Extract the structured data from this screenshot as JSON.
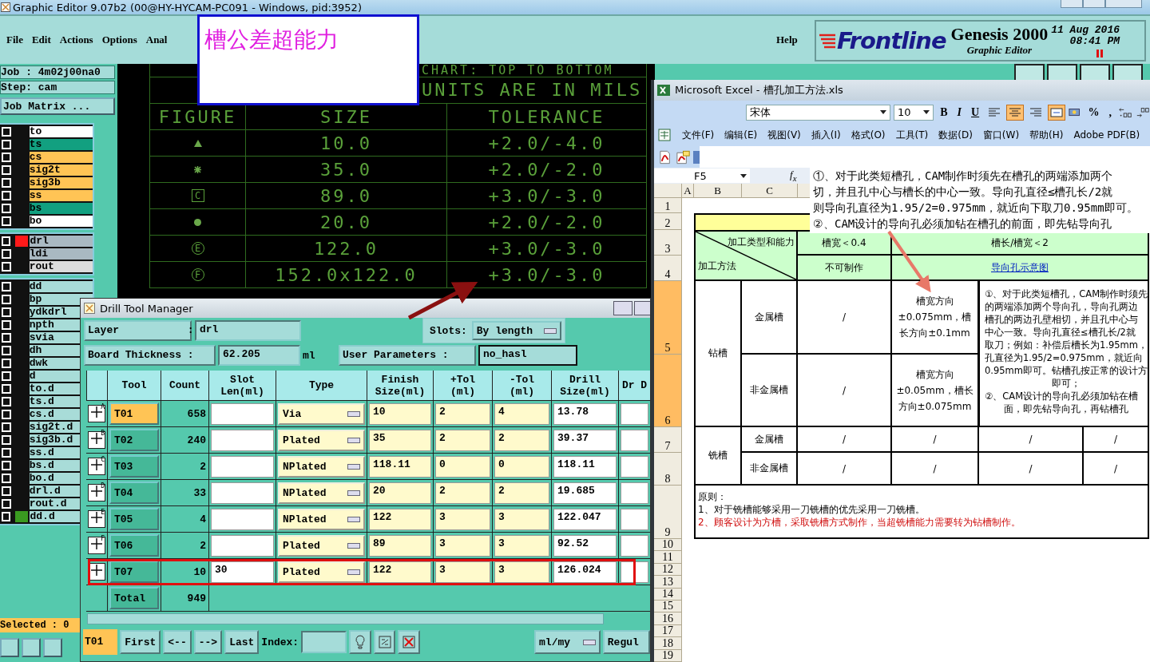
{
  "main_window": {
    "title": "Graphic Editor 9.07b2 (00@HY-HYCAM-PC091 - Windows, pid:3952)"
  },
  "menu": [
    "File",
    "Edit",
    "Actions",
    "Options",
    "Anal"
  ],
  "help_menu": "Help",
  "brand": {
    "logo": "Frontline",
    "product": "Genesis 2000",
    "subtitle": "Graphic Editor",
    "date": "11 Aug  2016",
    "time": "08:41  PM"
  },
  "overlay_note": "槽公差超能力",
  "job": {
    "job": "Job : 4m02j00na0",
    "step": "Step: cam",
    "matrix_button": "Job Matrix ..."
  },
  "layer_groups": [
    [
      {
        "name": "to",
        "color": "#ffffff",
        "checked": false
      },
      {
        "name": "ts",
        "color": "#12a080",
        "checked": false
      },
      {
        "name": "cs",
        "color": "#ffc455",
        "checked": false
      },
      {
        "name": "sig2t",
        "color": "#ffc455",
        "checked": false
      },
      {
        "name": "sig3b",
        "color": "#ffc455",
        "checked": false
      },
      {
        "name": "ss",
        "color": "#ffc455",
        "checked": false
      },
      {
        "name": "bs",
        "color": "#12a080",
        "checked": false
      },
      {
        "name": "bo",
        "color": "#ffffff",
        "checked": false
      }
    ],
    [
      {
        "name": "drl",
        "color": "#a9b9c2",
        "checked": false,
        "swatch": {
          "color": "#ff1a1a"
        }
      },
      {
        "name": "ldi",
        "color": "#a9b9c2",
        "checked": false
      },
      {
        "name": "rout",
        "color": "#dcdcdc",
        "checked": false
      }
    ],
    [
      {
        "name": "dd",
        "color": "#a8dcd8",
        "checked": false
      },
      {
        "name": "bp",
        "color": "#a8dcd8",
        "checked": false
      },
      {
        "name": "ydkdrl",
        "color": "#a8dcd8",
        "checked": false
      },
      {
        "name": "npth",
        "color": "#a8dcd8",
        "checked": false
      },
      {
        "name": "svia",
        "color": "#a8dcd8",
        "checked": false
      },
      {
        "name": "dh",
        "color": "#a8dcd8",
        "checked": false
      },
      {
        "name": "dwk",
        "color": "#a8dcd8",
        "checked": false
      },
      {
        "name": "d",
        "color": "#a8dcd8",
        "checked": false
      },
      {
        "name": "to.d",
        "color": "#a8dcd8",
        "checked": false
      },
      {
        "name": "ts.d",
        "color": "#a8dcd8",
        "checked": false
      },
      {
        "name": "cs.d",
        "color": "#a8dcd8",
        "checked": false
      },
      {
        "name": "sig2t.d",
        "color": "#a8dcd8",
        "checked": false
      },
      {
        "name": "sig3b.d",
        "color": "#a8dcd8",
        "checked": false
      },
      {
        "name": "ss.d",
        "color": "#a8dcd8",
        "checked": false
      },
      {
        "name": "bs.d",
        "color": "#a8dcd8",
        "checked": false
      },
      {
        "name": "bo.d",
        "color": "#a8dcd8",
        "checked": false
      },
      {
        "name": "drl.d",
        "color": "#a8dcd8",
        "checked": false
      },
      {
        "name": "rout.d",
        "color": "#a8dcd8",
        "checked": false
      },
      {
        "name": "dd.d",
        "color": "#a8dcd8",
        "checked": false,
        "swatch": {
          "color": "#3a9a20"
        }
      }
    ]
  ],
  "selected_count": "Selected : 0",
  "chart": {
    "title": "CHART: TOP TO BOTTOM",
    "units": "UNITS ARE IN MILS",
    "columns": [
      "FIGURE",
      "SIZE",
      "TOLERANCE"
    ],
    "rows": [
      {
        "kind": "triangle",
        "size": "10.0",
        "tolerance": "+2.0/-4.0"
      },
      {
        "kind": "star",
        "size": "35.0",
        "tolerance": "+2.0/-2.0"
      },
      {
        "kind": "boxed",
        "symbol": "C",
        "size": "89.0",
        "tolerance": "+3.0/-3.0"
      },
      {
        "kind": "dot",
        "size": "20.0",
        "tolerance": "+2.0/-2.0"
      },
      {
        "kind": "circled",
        "symbol": "E",
        "size": "122.0",
        "tolerance": "+3.0/-3.0"
      },
      {
        "kind": "circled",
        "symbol": "F",
        "size": "152.0x122.0",
        "tolerance": "+3.0/-3.0"
      }
    ]
  },
  "drill_tool_manager": {
    "title": "Drill Tool Manager",
    "layer_label": "Layer           :",
    "layer": "drl",
    "slots_label": "Slots:",
    "slots": "By length",
    "thickness_label": "Board Thickness :",
    "thickness": "62.205",
    "thickness_unit": "ml",
    "params_label": "User Parameters :",
    "params": "no_hasl",
    "columns": [
      "Tool",
      "Count",
      "Slot Len(ml)",
      "Type",
      "Finish Size(ml)",
      "+Tol (ml)",
      "-Tol (ml)",
      "Drill Size(ml)",
      "Dr D"
    ],
    "rows": [
      {
        "letter": "A",
        "tool": "T01",
        "selected": true,
        "count": "658",
        "type": "Via",
        "finish": "10",
        "plus_tol": "2",
        "minus_tol": "4",
        "drill": "13.78"
      },
      {
        "letter": "B",
        "tool": "T02",
        "selected": false,
        "count": "240",
        "type": "Plated",
        "finish": "35",
        "plus_tol": "2",
        "minus_tol": "2",
        "drill": "39.37"
      },
      {
        "letter": "C",
        "tool": "T03",
        "selected": false,
        "count": "2",
        "type": "NPlated",
        "finish": "118.11",
        "plus_tol": "0",
        "minus_tol": "0",
        "drill": "118.11"
      },
      {
        "letter": "D",
        "tool": "T04",
        "selected": false,
        "count": "33",
        "type": "NPlated",
        "finish": "20",
        "plus_tol": "2",
        "minus_tol": "2",
        "drill": "19.685"
      },
      {
        "letter": "E",
        "tool": "T05",
        "selected": false,
        "count": "4",
        "type": "NPlated",
        "finish": "122",
        "plus_tol": "3",
        "minus_tol": "3",
        "drill": "122.047"
      },
      {
        "letter": "F",
        "tool": "T06",
        "selected": false,
        "count": "2",
        "type": "Plated",
        "finish": "89",
        "plus_tol": "3",
        "minus_tol": "3",
        "drill": "92.52"
      },
      {
        "tool": "T07",
        "selected": false,
        "count": "10",
        "slot_len": "30",
        "type": "Plated",
        "finish": "122",
        "plus_tol": "3",
        "minus_tol": "3",
        "drill": "126.024"
      }
    ],
    "total_label": "Total",
    "total": "949",
    "current_tool": "T01",
    "nav_buttons": [
      "First",
      "<--",
      "-->",
      "Last"
    ],
    "index_label": "Index:",
    "units": "ml/my",
    "cut_button": "Regul"
  },
  "excel": {
    "title": "Microsoft Excel - 槽孔加工方法.xls",
    "font": "宋体",
    "font_size": "10",
    "format_buttons": [
      "B",
      "I",
      "U"
    ],
    "align_buttons": [
      {
        "kind": "left",
        "selected": false
      },
      {
        "kind": "center",
        "selected": true
      },
      {
        "kind": "right",
        "selected": false
      },
      {
        "kind": "merge",
        "selected": true
      }
    ],
    "number_buttons": [
      "%",
      ","
    ],
    "menu": [
      "文件(F)",
      "编辑(E)",
      "视图(V)",
      "插入(I)",
      "格式(O)",
      "工具(T)",
      "数据(D)",
      "窗口(W)",
      "帮助(H)",
      "Adobe PDF(B)"
    ],
    "name_box": "F5",
    "function_label": "f$_{x}$",
    "formula_lines": [
      "①、对于此类短槽孔，CAM制作时须先在槽孔的两端添加两个",
      "切，并且孔中心与槽长的中心一致。导向孔直径≤槽孔长/2就",
      "则导向孔直径为1.95/2=0.975mm，就近向下取刀0.95mm即可。",
      "②、CAM设计的导向孔必须加钻在槽孔的前面，即先钻导向孔"
    ],
    "col_headers": [
      "A",
      "B",
      "C"
    ],
    "row_headers": [
      {
        "label": "1",
        "selected": false
      },
      {
        "label": "2",
        "selected": false
      },
      {
        "label": "3",
        "selected": false
      },
      {
        "label": "4",
        "selected": false
      },
      {
        "label": "5",
        "selected": true
      },
      {
        "label": "6",
        "selected": true
      },
      {
        "label": "7",
        "selected": false
      },
      {
        "label": "8",
        "selected": false
      },
      {
        "label": "9",
        "selected": false
      },
      {
        "label": "10",
        "selected": false
      },
      {
        "label": "11",
        "selected": false
      },
      {
        "label": "12",
        "selected": false
      },
      {
        "label": "13",
        "selected": false
      },
      {
        "label": "14",
        "selected": false
      },
      {
        "label": "15",
        "selected": false
      },
      {
        "label": "16",
        "selected": false
      },
      {
        "label": "17",
        "selected": false
      },
      {
        "label": "18",
        "selected": false
      },
      {
        "label": "19",
        "selected": false
      }
    ],
    "table": {
      "corner_top": "加工类型和能力",
      "corner_bottom": "加工方法",
      "width_header": "槽宽＜0.4",
      "ratio_header": "槽长/槽宽＜2",
      "not_possible": "不可制作",
      "guide_link": "导向孔示意图",
      "drill_group": "钻槽",
      "mill_group": "铣槽",
      "drill_rows": [
        {
          "label": "金属槽",
          "cells": [
            "/",
            "槽宽方向±0.075mm，槽长方向±0.1mm"
          ]
        },
        {
          "label": "非金属槽",
          "cells": [
            "/",
            "槽宽方向±0.05mm，槽长方向±0.075mm"
          ]
        }
      ],
      "note_lines": [
        "①、对于此类短槽孔，CAM制作时须先",
        "的两端添加两个导向孔，导向孔两边",
        "槽孔的两边孔壁相切，并且孔中心与",
        "中心一致。导向孔直径≤槽孔长/2就",
        "取刀；例如：补偿后槽长为1.95mm，",
        "孔直径为1.95/2=0.975mm，就近向",
        "0.95mm即可。钻槽孔按正常的设计方",
        "即可；",
        "②、CAM设计的导向孔必须加钻在槽",
        "面，即先钻导向孔，再钻槽孔"
      ],
      "mill_rows": [
        {
          "label": "金属槽",
          "cells": [
            "/",
            "/",
            "/",
            "/"
          ]
        },
        {
          "label": "非金属槽",
          "cells": [
            "/",
            "/",
            "/",
            "/"
          ]
        }
      ],
      "principle_title": "原则：",
      "principles": [
        {
          "text": "1、对于铣槽能够采用一刀铣槽的优先采用一刀铣槽。",
          "warning": false
        },
        {
          "text": "2、顾客设计为方槽，采取铣槽方式制作，当超铣槽能力需要转为钻槽制作。",
          "warning": true
        }
      ]
    }
  }
}
